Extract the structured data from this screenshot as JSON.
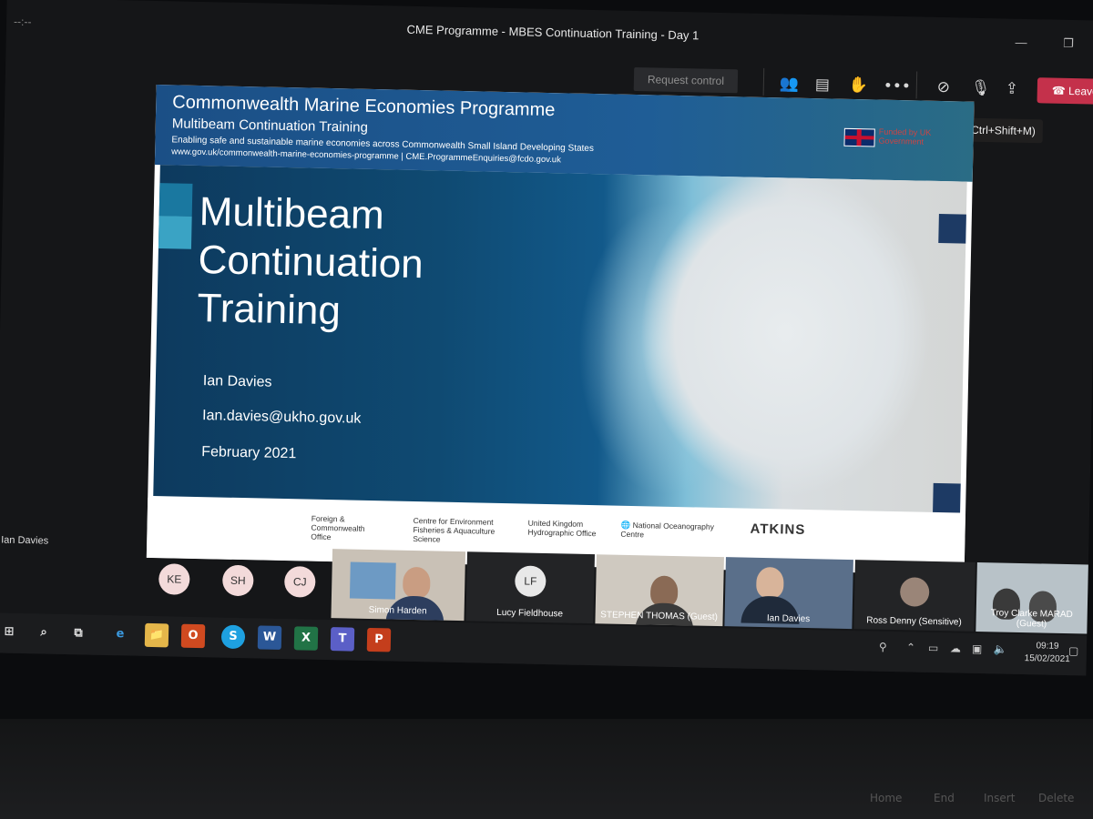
{
  "window": {
    "title": "CME Programme - MBES Continuation Training - Day 1",
    "left_mark": "--:--"
  },
  "toolbar": {
    "request_control": "Request control",
    "people_icon": "people-icon",
    "chat_icon": "chat-icon",
    "raise_hand_icon": "raise-hand-icon",
    "more_label": "•••",
    "camera_off_icon": "camera-off-icon",
    "mic_muted_icon": "mic-muted-icon",
    "share_icon": "share-tray-icon",
    "leave_label": "Leave",
    "tooltip": "Unmute (Ctrl+Shift+M)"
  },
  "slide": {
    "header_title": "Commonwealth Marine Economies Programme",
    "header_subtitle": "Multibeam Continuation Training",
    "header_tagline": "Enabling safe and sustainable marine economies across Commonwealth Small Island Developing States",
    "header_links": "www.gov.uk/commonwealth-marine-economies-programme | CME.ProgrammeEnquiries@fcdo.gov.uk",
    "funded": "Funded by UK Government",
    "title_line1": "Multibeam",
    "title_line2": "Continuation",
    "title_line3": "Training",
    "presenter": "Ian Davies",
    "email": "Ian.davies@ukho.gov.uk",
    "date": "February 2021",
    "logos": {
      "fcdo": "Foreign & Commonwealth Office",
      "cefas": "Centre for Environment Fisheries & Aquaculture Science",
      "ukho": "United Kingdom Hydrographic Office",
      "noc": "National Oceanography Centre",
      "atkins": "ATKINS"
    }
  },
  "presenter_label": "Ian Davies",
  "participants": {
    "avatars": [
      "KE",
      "SH",
      "CJ"
    ],
    "tiles": [
      {
        "name": "Simon Harden"
      },
      {
        "initials": "LF",
        "name": "Lucy Fieldhouse"
      },
      {
        "name": "STEPHEN THOMAS (Guest)"
      },
      {
        "name": "Ian Davies"
      },
      {
        "name": "Ross Denny (Sensitive)"
      },
      {
        "name": "Troy Clarke MARAD (Guest)"
      }
    ]
  },
  "taskbar": {
    "apps": [
      "e",
      "📁",
      "O",
      "S",
      "W",
      "X",
      "T",
      "P"
    ],
    "time": "09:19",
    "date": "15/02/2021"
  },
  "keyboard": {
    "home": "Home",
    "end": "End",
    "insert": "Insert",
    "delete": "Delete"
  }
}
